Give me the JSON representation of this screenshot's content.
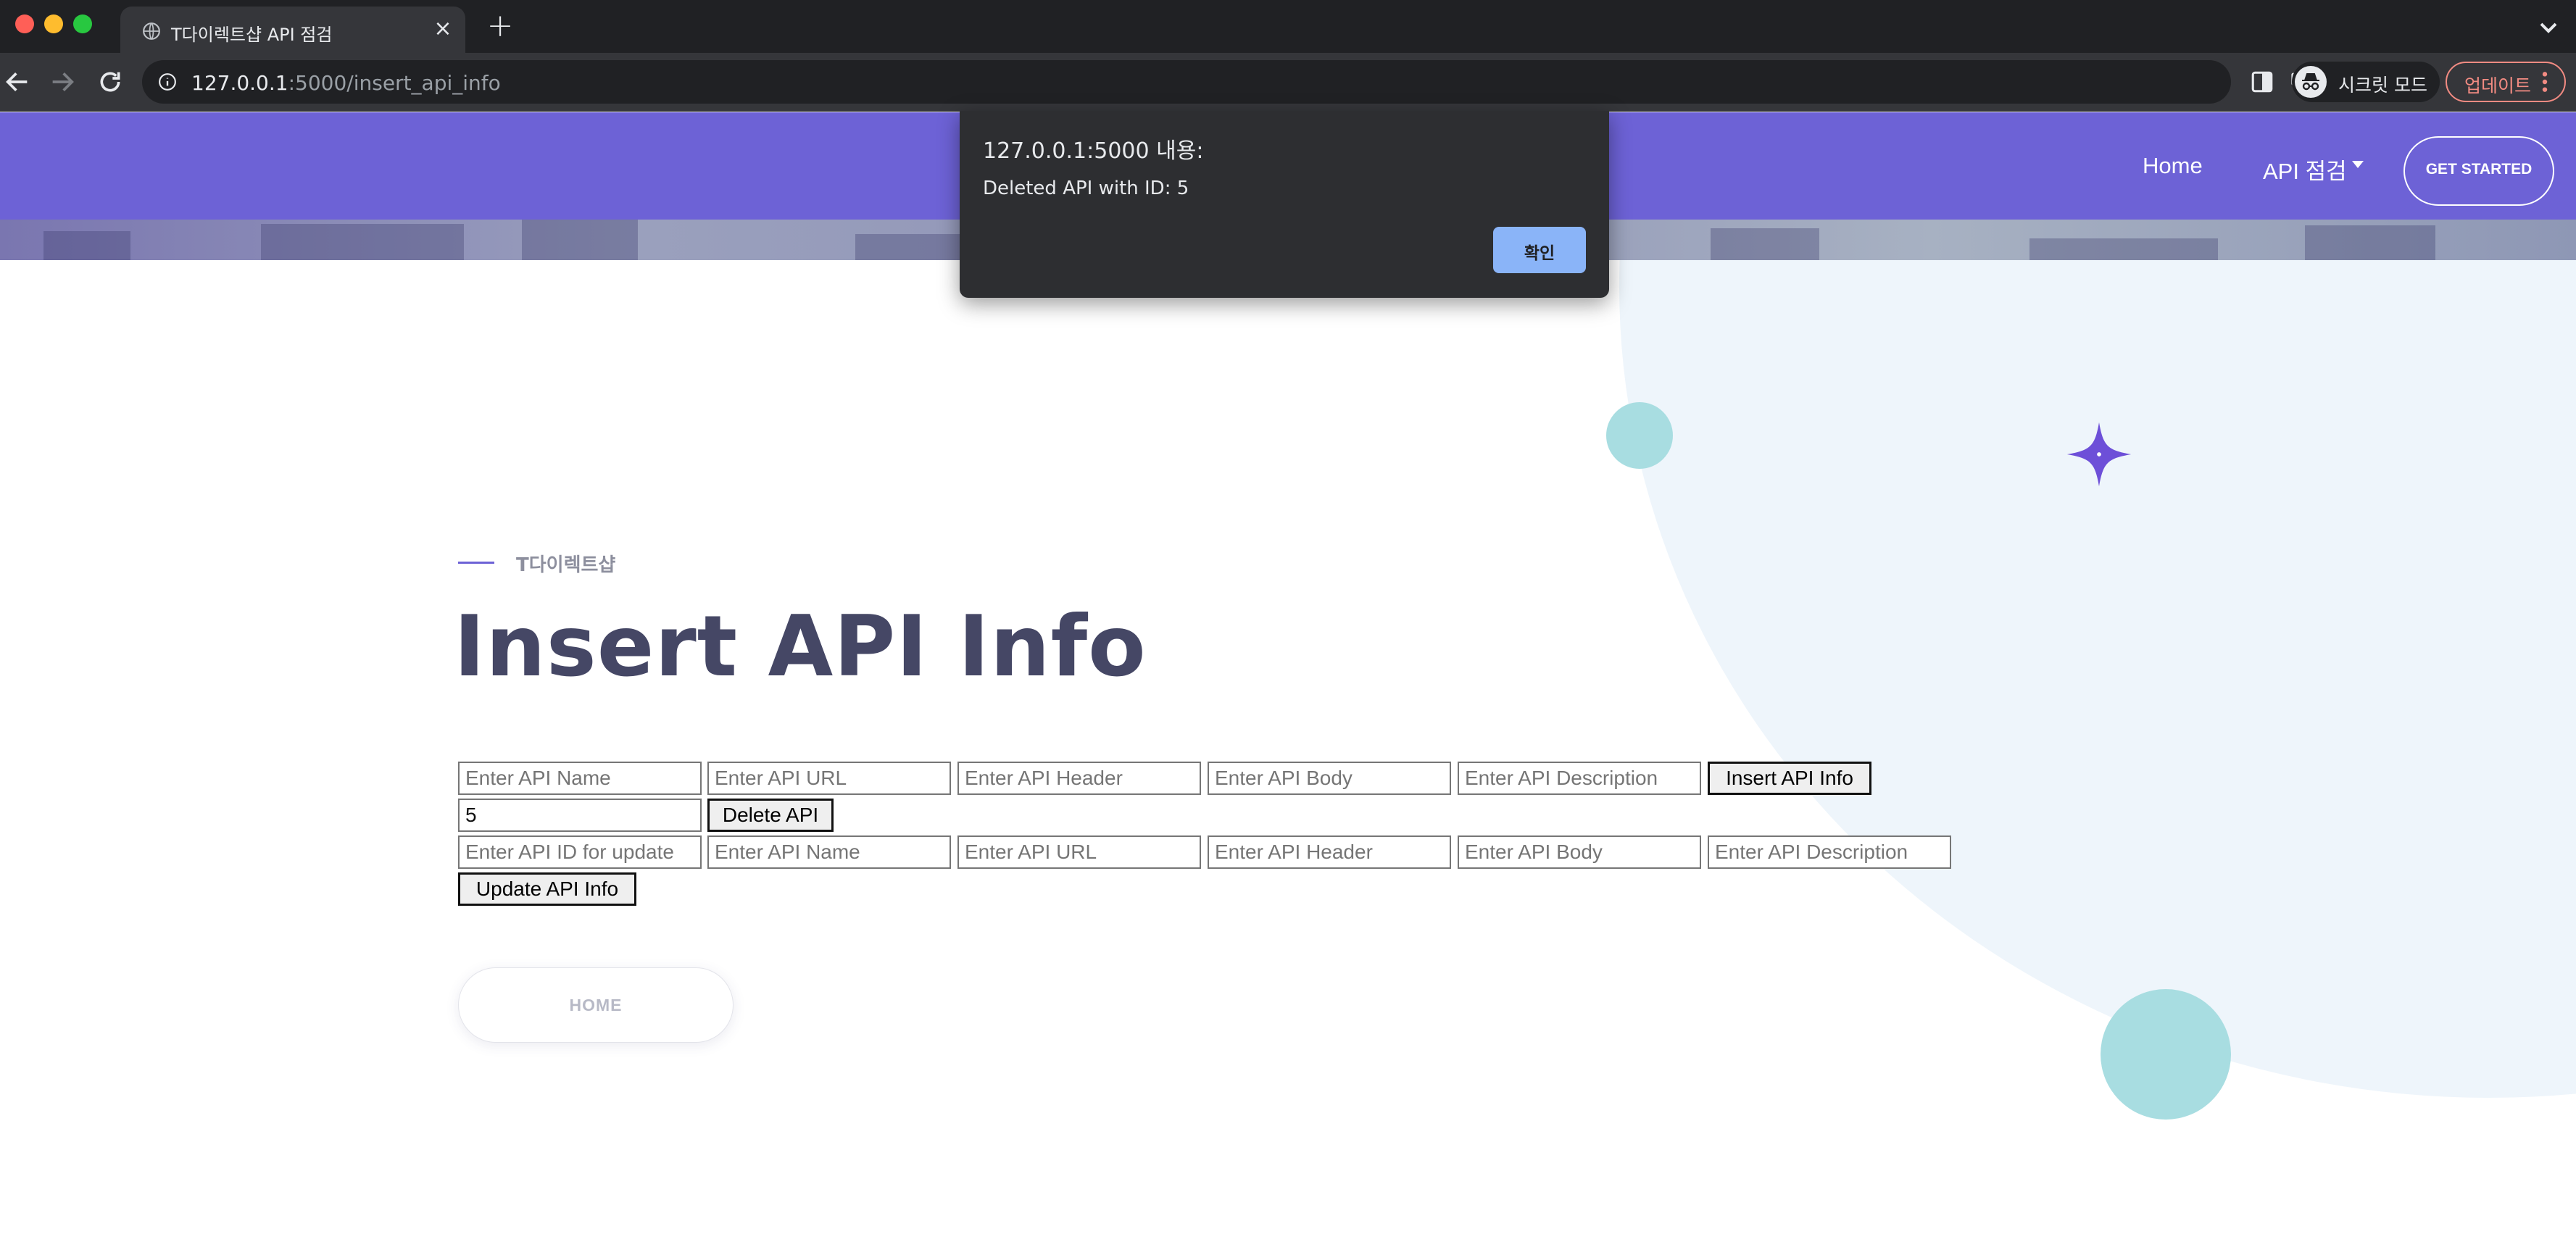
{
  "browser": {
    "tab_title": "T다이렉트샵 API 점검",
    "url_host": "127.0.0.1",
    "url_rest": ":5000/insert_api_info",
    "incognito_label": "시크릿 모드",
    "update_label": "업데이트"
  },
  "header": {
    "nav": [
      {
        "label": "Home"
      },
      {
        "label": "API 점검"
      }
    ],
    "cta_label": "GET STARTED"
  },
  "hero": {
    "eyebrow": "T다이렉트샵",
    "title": "Insert API Info"
  },
  "insert_form": {
    "name_placeholder": "Enter API Name",
    "url_placeholder": "Enter API URL",
    "header_placeholder": "Enter API Header",
    "body_placeholder": "Enter API Body",
    "description_placeholder": "Enter API Description",
    "submit_label": "Insert API Info"
  },
  "delete_form": {
    "id_value": "5",
    "submit_label": "Delete API"
  },
  "update_form": {
    "id_placeholder": "Enter API ID for update",
    "name_placeholder": "Enter API Name",
    "url_placeholder": "Enter API URL",
    "header_placeholder": "Enter API Header",
    "body_placeholder": "Enter API Body",
    "description_placeholder": "Enter API Description",
    "submit_label": "Update API Info"
  },
  "home_button_label": "HOME",
  "dialog": {
    "title": "127.0.0.1:5000 내용:",
    "message": "Deleted API with ID: 5",
    "ok_label": "확인"
  },
  "colors": {
    "header_bg": "#6d62d6",
    "accent_circle": "#a8dde1",
    "blob": "#eef5fb",
    "dialog_button": "#8ab4f8"
  }
}
